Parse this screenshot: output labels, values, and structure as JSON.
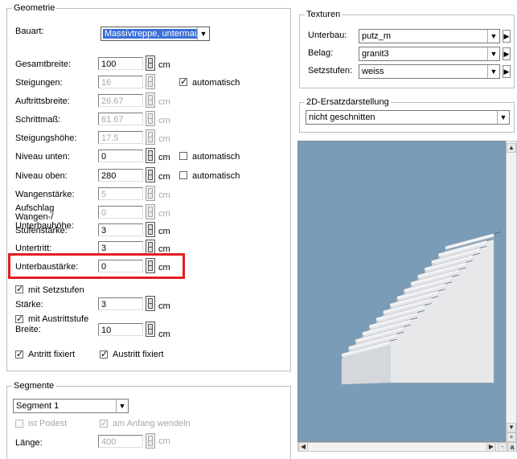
{
  "geometrie": {
    "title": "Geometrie",
    "bauart_label": "Bauart:",
    "bauart_value": "Massivtreppe, untermau",
    "rows": [
      {
        "label": "Gesamtbreite:",
        "value": "100",
        "unit": "cm",
        "disabled": false
      },
      {
        "label": "Steigungen:",
        "value": "16",
        "unit": "",
        "disabled": true
      },
      {
        "label": "Auftrittsbreite:",
        "value": "26.67",
        "unit": "cm",
        "disabled": true
      },
      {
        "label": "Schrittmaß:",
        "value": "61.67",
        "unit": "cm",
        "disabled": true
      },
      {
        "label": "Steigungshöhe:",
        "value": "17.5",
        "unit": "cm",
        "disabled": true
      },
      {
        "label": "Niveau unten:",
        "value": "0",
        "unit": "cm",
        "disabled": false
      },
      {
        "label": "Niveau oben:",
        "value": "280",
        "unit": "cm",
        "disabled": false
      },
      {
        "label": "Wangenstärke:",
        "value": "5",
        "unit": "cm",
        "disabled": true
      },
      {
        "label": "Aufschlag Wangen-/ Unterbauhöhe:",
        "value": "0",
        "unit": "cm",
        "disabled": true
      },
      {
        "label": "Stufenstärke:",
        "value": "3",
        "unit": "cm",
        "disabled": false
      },
      {
        "label": "Untertritt:",
        "value": "3",
        "unit": "cm",
        "disabled": false
      },
      {
        "label": "Unterbaustärke:",
        "value": "0",
        "unit": "cm",
        "disabled": false
      }
    ],
    "auto_steigungen": "automatisch",
    "auto_niveau_unten": "automatisch",
    "auto_niveau_oben": "automatisch",
    "setzstufen_label": "mit Setzstufen",
    "staerke_label": "Stärke:",
    "staerke_value": "3",
    "staerke_unit": "cm",
    "austrittstufe_label": "mit Austrittstufe",
    "breite_label": "Breite:",
    "breite_value": "10",
    "breite_unit": "cm",
    "antritt_label": "Antritt fixiert",
    "austritt_label": "Austritt fixiert"
  },
  "segmente": {
    "title": "Segmente",
    "segment_value": "Segment 1",
    "ist_podest": "ist Podest",
    "am_anfang": "am Anfang wendeln",
    "laenge_label": "Länge:",
    "laenge_value": "400",
    "laenge_unit": "cm"
  },
  "texturen": {
    "title": "Texturen",
    "unterbau_label": "Unterbau:",
    "unterbau_value": "putz_m",
    "belag_label": "Belag:",
    "belag_value": "granit3",
    "setzstufen_label": "Setzstufen:",
    "setzstufen_value": "weiss"
  },
  "ersatz": {
    "title": "2D-Ersatzdarstellung",
    "value": "nicht geschnitten"
  },
  "preview": {
    "bg_color": "#7a9cb6",
    "scroll_corner_label": "a"
  },
  "highlight_color": "#e51c23"
}
